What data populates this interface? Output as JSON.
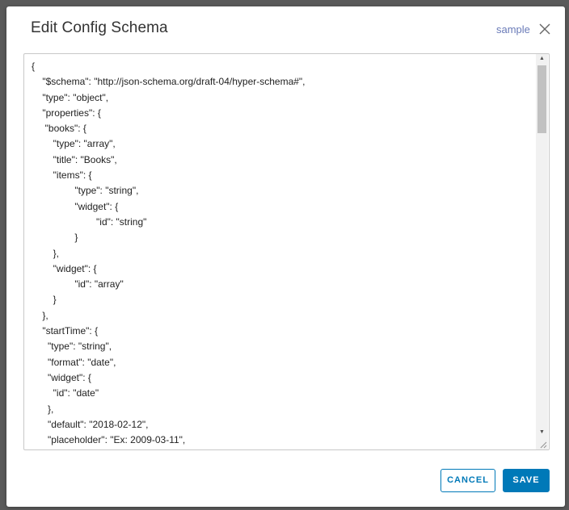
{
  "dialog": {
    "title": "Edit Config Schema",
    "sample_link": "sample",
    "close_icon": "close-icon"
  },
  "editor": {
    "content": "{\n    \"$schema\": \"http://json-schema.org/draft-04/hyper-schema#\",\n    \"type\": \"object\",\n    \"properties\": {\n     \"books\": {\n        \"type\": \"array\",\n        \"title\": \"Books\",\n        \"items\": {\n                \"type\": \"string\",\n                \"widget\": {\n                        \"id\": \"string\"\n                }\n        },\n        \"widget\": {\n                \"id\": \"array\"\n        }\n    },\n    \"startTime\": {\n      \"type\": \"string\",\n      \"format\": \"date\",\n      \"widget\": {\n        \"id\": \"date\"\n      },\n      \"default\": \"2018-02-12\",\n      \"placeholder\": \"Ex: 2009-03-11\","
  },
  "footer": {
    "cancel_label": "CANCEL",
    "save_label": "SAVE"
  },
  "colors": {
    "primary": "#0079b8",
    "link": "#6a7bb8"
  }
}
